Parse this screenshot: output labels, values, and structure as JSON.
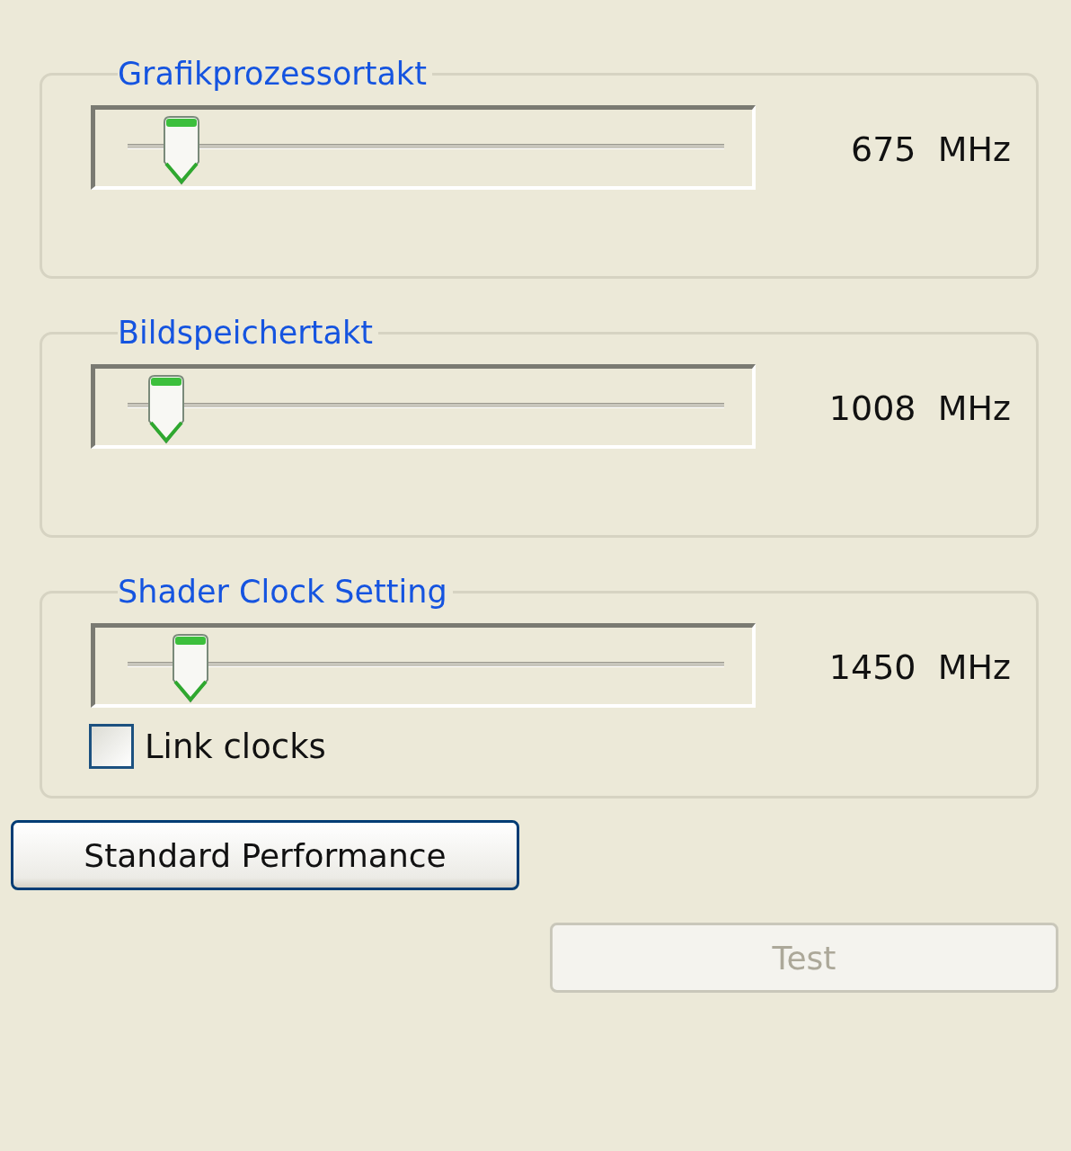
{
  "groups": [
    {
      "title": "Grafikprozessortakt",
      "slider": {
        "level": 0.09
      },
      "reading": "675  MHz"
    },
    {
      "title": "Bildspeichertakt",
      "slider": {
        "level": 0.065
      },
      "reading": "1008  MHz"
    },
    {
      "title": "Shader Clock Setting",
      "slider": {
        "level": 0.105
      },
      "reading": "1450  MHz",
      "checkbox": {
        "label": "Link clocks",
        "checked": false
      }
    }
  ],
  "buttons": [
    {
      "label": "Standard Performance",
      "disabled": false
    },
    {
      "label": "Test",
      "disabled": true
    }
  ]
}
